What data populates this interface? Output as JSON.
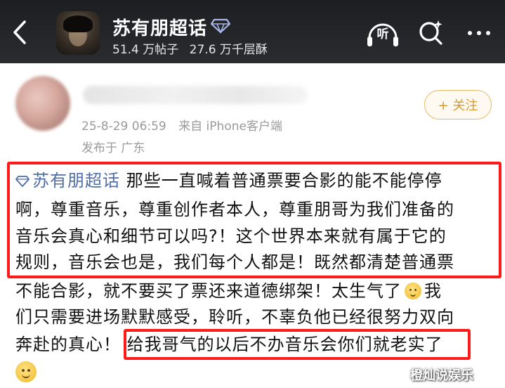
{
  "header": {
    "title": "苏有朋超话",
    "posts_count": "51.4 万帖子",
    "likes_count": "27.6 万千层酥",
    "listen_label": "听",
    "icons": {
      "back": "chevron-left-icon",
      "verify": "diamond-icon",
      "search": "search-sparkle-icon",
      "more": "more-dots-icon"
    }
  },
  "post": {
    "timestamp": "25-8-29 06:59",
    "source": "来自 iPhone客户端",
    "location": "发布于 广东",
    "follow_label": "+ 关注",
    "topic": "苏有朋超话",
    "lines": [
      "那些一直喊着普通票要合影的能不能停停",
      "啊，尊重音乐，尊重创作者本人，尊重朋哥为我们准备的",
      "音乐会真心和细节可以吗?！这个世界本来就有属于它的",
      "规则，音乐会也是，我们每个人都是！既然都清楚普通票",
      "不能合影，就不要买了票还来道德绑架！太生气了",
      "我",
      "们只需要进场默默感受，聆听，不辜负他已经很努力双向",
      "奔赴的真心！",
      "给我哥气的以后不办音乐会你们就老实了"
    ]
  },
  "watermark": "橙灿说娱乐",
  "colors": {
    "header_bg": "#1c1e22",
    "topic_link": "#4f6ea8",
    "highlight_border": "#ff1a1a",
    "follow_accent": "#d79a32",
    "meta_text": "#9a9a9a"
  }
}
